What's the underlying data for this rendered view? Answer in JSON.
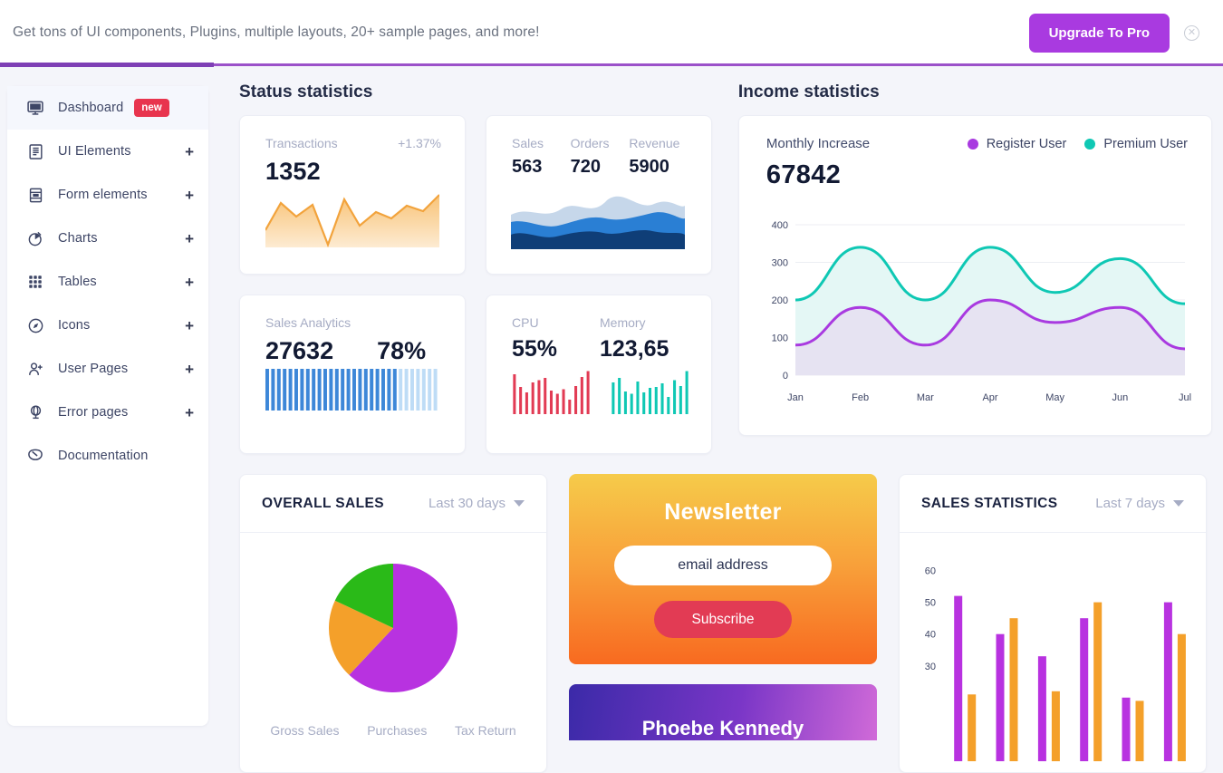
{
  "promo": {
    "text": "Get tons of UI components, Plugins, multiple layouts, 20+ sample pages, and more!",
    "upgrade_label": "Upgrade To Pro",
    "close_icon": "close-circle-icon"
  },
  "sidebar": {
    "items": [
      {
        "label": "Dashboard",
        "icon": "monitor-icon",
        "badge": "new",
        "plus": "",
        "active": true
      },
      {
        "label": "UI Elements",
        "icon": "document-icon",
        "badge": "",
        "plus": "+",
        "active": false
      },
      {
        "label": "Form elements",
        "icon": "form-icon",
        "badge": "",
        "plus": "+",
        "active": false
      },
      {
        "label": "Charts",
        "icon": "pie-chart-icon",
        "badge": "",
        "plus": "+",
        "active": false
      },
      {
        "label": "Tables",
        "icon": "grid-icon",
        "badge": "",
        "plus": "+",
        "active": false
      },
      {
        "label": "Icons",
        "icon": "compass-icon",
        "badge": "",
        "plus": "+",
        "active": false
      },
      {
        "label": "User Pages",
        "icon": "user-add-icon",
        "badge": "",
        "plus": "+",
        "active": false
      },
      {
        "label": "Error pages",
        "icon": "globe-icon",
        "badge": "",
        "plus": "+",
        "active": false
      },
      {
        "label": "Documentation",
        "icon": "book-icon",
        "badge": "",
        "plus": "",
        "active": false
      }
    ]
  },
  "status_section": {
    "title": "Status statistics"
  },
  "income_section": {
    "title": "Income statistics"
  },
  "cards": {
    "transactions": {
      "label": "Transactions",
      "delta": "+1.37%",
      "value": "1352"
    },
    "sales_orders": {
      "labels": [
        "Sales",
        "Orders",
        "Revenue"
      ],
      "values": [
        "563",
        "720",
        "5900"
      ]
    },
    "sales_analytics": {
      "label": "Sales Analytics",
      "value": "27632",
      "percent": "78%"
    },
    "cpu_memory": {
      "labels": [
        "CPU",
        "Memory"
      ],
      "values": [
        "55%",
        "123,65"
      ]
    }
  },
  "income_card": {
    "label": "Monthly Increase",
    "value": "67842",
    "legend": [
      {
        "name": "Register User",
        "color": "#a93ae0"
      },
      {
        "name": "Premium User",
        "color": "#0fc8b4"
      }
    ]
  },
  "overall_sales": {
    "title": "OVERALL SALES",
    "range": "Last 30 days",
    "legend": [
      "Gross Sales",
      "Purchases",
      "Tax Return"
    ]
  },
  "newsletter": {
    "title": "Newsletter",
    "placeholder": "email address",
    "button": "Subscribe"
  },
  "profile": {
    "name": "Phoebe Kennedy"
  },
  "sales_statistics": {
    "title": "SALES STATISTICS",
    "range": "Last 7 days"
  },
  "colors": {
    "accent_purple": "#a93ae0",
    "teal": "#0fc8b4",
    "orange": "#f2a33c",
    "red": "#e23b54",
    "blue": "#3d87d8",
    "badge_red": "#e8344e",
    "promo_purple": "#9b51c9"
  },
  "chart_data": [
    {
      "type": "area",
      "name": "transactions-sparkline",
      "title": "Transactions",
      "values": [
        30,
        78,
        52,
        76,
        5,
        82,
        35,
        60,
        48,
        70,
        55,
        90
      ],
      "ylim": [
        0,
        100
      ],
      "grid": false,
      "series_color": "#f2a33c"
    },
    {
      "type": "area",
      "name": "sales-orders-stacked-area",
      "title": "Sales / Orders / Revenue",
      "series": [
        {
          "name": "Revenue",
          "color": "#0f3e77",
          "values": [
            38,
            46,
            40,
            50,
            46,
            42,
            48,
            44,
            40,
            45
          ]
        },
        {
          "name": "Orders",
          "color": "#2a7fd4",
          "values": [
            66,
            62,
            56,
            68,
            64,
            60,
            70,
            66,
            62,
            68
          ]
        },
        {
          "name": "Sales",
          "color": "#c6d7ea",
          "values": [
            82,
            90,
            84,
            97,
            86,
            96,
            88,
            94,
            86,
            92
          ]
        }
      ],
      "ylim": [
        0,
        100
      ],
      "grid": false
    },
    {
      "type": "bar",
      "name": "sales-analytics-progress",
      "title": "Sales Analytics",
      "percent": 78,
      "bars": 30,
      "filled_color": "#3d87d8",
      "empty_color": "#bedcf6"
    },
    {
      "type": "bar",
      "name": "cpu-sparkbars",
      "title": "CPU",
      "values": [
        88,
        60,
        48,
        70,
        75,
        80,
        52,
        45,
        55,
        32,
        62,
        82,
        95
      ],
      "ylim": [
        0,
        100
      ],
      "series_color": "#e23b54"
    },
    {
      "type": "bar",
      "name": "memory-sparkbars",
      "title": "Memory",
      "values": [
        70,
        80,
        50,
        45,
        72,
        48,
        58,
        60,
        68,
        38,
        75,
        62,
        95
      ],
      "ylim": [
        0,
        100
      ],
      "series_color": "#0fc8b4"
    },
    {
      "type": "area",
      "name": "income-statistics",
      "title": "Monthly Increase",
      "categories": [
        "Jan",
        "Feb",
        "Mar",
        "Apr",
        "May",
        "Jun",
        "Jul"
      ],
      "series": [
        {
          "name": "Premium User",
          "color": "#0fc8b4",
          "values": [
            200,
            340,
            200,
            340,
            220,
            310,
            190
          ]
        },
        {
          "name": "Register User",
          "color": "#a93ae0",
          "values": [
            80,
            180,
            80,
            200,
            140,
            180,
            70
          ]
        }
      ],
      "ylim": [
        0,
        400
      ],
      "yticks": [
        0,
        100,
        200,
        300,
        400
      ],
      "xlabel": "",
      "ylabel": "",
      "grid": true,
      "legend_position": "top-right"
    },
    {
      "type": "pie",
      "name": "overall-sales-pie",
      "title": "OVERALL SALES",
      "labels": [
        "Gross Sales",
        "Purchases",
        "Tax Return"
      ],
      "values": [
        62,
        20,
        18
      ],
      "colors": [
        "#b832e0",
        "#f4a02a",
        "#2aba18"
      ]
    },
    {
      "type": "bar",
      "name": "sales-statistics-bars",
      "title": "SALES STATISTICS",
      "yticks": [
        30,
        40,
        50,
        60
      ],
      "ylim": [
        0,
        65
      ],
      "series": [
        {
          "name": "Register User",
          "color": "#b832e0",
          "values": [
            52,
            40,
            33,
            45,
            20,
            50
          ]
        },
        {
          "name": "Premium User",
          "color": "#f4a02a",
          "values": [
            21,
            45,
            22,
            50,
            19,
            40
          ]
        }
      ],
      "grid": false
    }
  ]
}
